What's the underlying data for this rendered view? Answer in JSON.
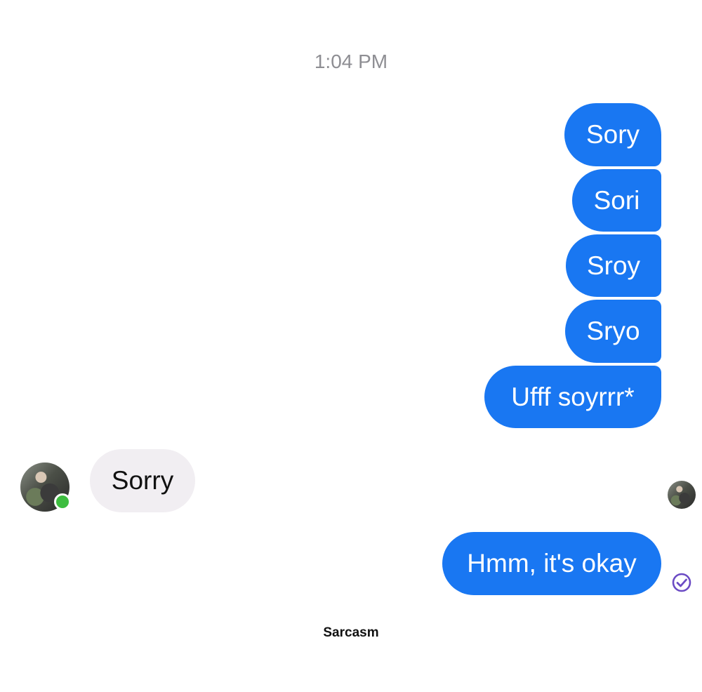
{
  "conversation": {
    "timestamp": "1:04 PM",
    "messages": [
      {
        "text": "Sory",
        "direction": "outgoing"
      },
      {
        "text": "Sori",
        "direction": "outgoing"
      },
      {
        "text": "Sroy",
        "direction": "outgoing"
      },
      {
        "text": "Sryo",
        "direction": "outgoing"
      },
      {
        "text": "Ufff soyrrr*",
        "direction": "outgoing"
      },
      {
        "text": "Sorry",
        "direction": "incoming"
      },
      {
        "text": "Hmm, it's okay",
        "direction": "outgoing"
      }
    ]
  },
  "contact": {
    "online": true
  },
  "status": {
    "last_message_icon": "sent-check-icon"
  },
  "caption": "Sarcasm",
  "colors": {
    "outgoing_bubble": "#1977f2",
    "incoming_bubble": "#f1eef2",
    "online_dot": "#3dbd3f",
    "check_icon": "#6b4bc4"
  }
}
